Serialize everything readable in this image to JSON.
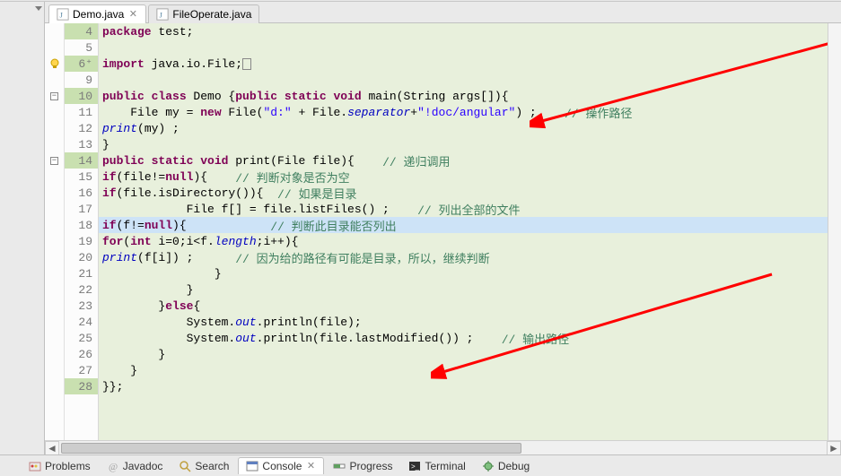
{
  "tabs": [
    {
      "label": "Demo.java",
      "active": true,
      "dirty": false
    },
    {
      "label": "FileOperate.java",
      "active": false,
      "dirty": false
    }
  ],
  "active_tab_close_glyph": "✕",
  "gutter": {
    "lines": [
      {
        "n": "4",
        "change": true
      },
      {
        "n": "5",
        "change": false
      },
      {
        "n": "6",
        "change": true,
        "bulb": true,
        "folded": true
      },
      {
        "n": "9",
        "change": false
      },
      {
        "n": "10",
        "change": true,
        "fold": "-"
      },
      {
        "n": "11",
        "change": false
      },
      {
        "n": "12",
        "change": false
      },
      {
        "n": "13",
        "change": false
      },
      {
        "n": "14",
        "change": true,
        "fold": "-"
      },
      {
        "n": "15",
        "change": false
      },
      {
        "n": "16",
        "change": false
      },
      {
        "n": "17",
        "change": false
      },
      {
        "n": "18",
        "change": false,
        "hl": true
      },
      {
        "n": "19",
        "change": false
      },
      {
        "n": "20",
        "change": false
      },
      {
        "n": "21",
        "change": false
      },
      {
        "n": "22",
        "change": false
      },
      {
        "n": "23",
        "change": false
      },
      {
        "n": "24",
        "change": false
      },
      {
        "n": "25",
        "change": false
      },
      {
        "n": "26",
        "change": false
      },
      {
        "n": "27",
        "change": false
      },
      {
        "n": "28",
        "change": true
      }
    ]
  },
  "code": {
    "l4": {
      "indent": "",
      "tokens": [
        [
          "kw",
          "package"
        ],
        [
          "",
          " test;"
        ]
      ]
    },
    "l5": {
      "indent": "",
      "tokens": []
    },
    "l6": {
      "indent": "",
      "tokens": [
        [
          "kw",
          "import"
        ],
        [
          "",
          " java.io.File;"
        ],
        [
          "box",
          "▢"
        ]
      ]
    },
    "l9": {
      "indent": "",
      "tokens": []
    },
    "l10": {
      "indent": "",
      "tokens": [
        [
          "kw",
          "public class"
        ],
        [
          "",
          " Demo {"
        ],
        [
          "kw",
          "public static void"
        ],
        [
          "",
          " main(String args[]){"
        ]
      ]
    },
    "l11": {
      "indent": "    ",
      "tokens": [
        [
          "",
          "File my = "
        ],
        [
          "kw",
          "new"
        ],
        [
          "",
          " File("
        ],
        [
          "str",
          "\"d:\""
        ],
        [
          "",
          " + File."
        ],
        [
          "field",
          "separator"
        ],
        [
          "",
          "+"
        ],
        [
          "str",
          "\"!doc/angular\""
        ],
        [
          "",
          ") ;    "
        ],
        [
          "cm",
          "// 操作路径"
        ]
      ]
    },
    "l12": {
      "indent": "    ",
      "tokens": [
        [
          "field",
          "print"
        ],
        [
          "",
          "(my) ;"
        ]
      ]
    },
    "l13": {
      "indent": "",
      "tokens": [
        [
          "",
          "}"
        ]
      ]
    },
    "l14": {
      "indent": "",
      "tokens": [
        [
          "kw",
          "public static void"
        ],
        [
          "",
          " print(File file){    "
        ],
        [
          "cm",
          "// 递归调用"
        ]
      ]
    },
    "l15": {
      "indent": "    ",
      "tokens": [
        [
          "kw",
          "if"
        ],
        [
          "",
          "(file!="
        ],
        [
          "kw",
          "null"
        ],
        [
          "",
          "){    "
        ],
        [
          "cm",
          "// 判断对象是否为空"
        ]
      ]
    },
    "l16": {
      "indent": "        ",
      "tokens": [
        [
          "kw",
          "if"
        ],
        [
          "",
          "(file.isDirectory()){  "
        ],
        [
          "cm",
          "// 如果是目录"
        ]
      ]
    },
    "l17": {
      "indent": "            ",
      "tokens": [
        [
          "",
          "File f[] = file.listFiles() ;    "
        ],
        [
          "cm",
          "// 列出全部的文件"
        ]
      ]
    },
    "l18": {
      "indent": "            ",
      "tokens": [
        [
          "kw",
          "if"
        ],
        [
          "",
          "(f!="
        ],
        [
          "kw",
          "null"
        ],
        [
          "",
          "){            "
        ],
        [
          "cm",
          "// 判断此目录能否列出"
        ]
      ]
    },
    "l19": {
      "indent": "                ",
      "tokens": [
        [
          "kw",
          "for"
        ],
        [
          "",
          "("
        ],
        [
          "kw",
          "int"
        ],
        [
          "",
          " i=0;i<f."
        ],
        [
          "field",
          "length"
        ],
        [
          "",
          ";i++){"
        ]
      ]
    },
    "l20": {
      "indent": "                    ",
      "tokens": [
        [
          "field",
          "print"
        ],
        [
          "",
          "(f[i]) ;      "
        ],
        [
          "cm",
          "// 因为给的路径有可能是目录，所以，继续判断"
        ]
      ]
    },
    "l21": {
      "indent": "                ",
      "tokens": [
        [
          "",
          "}"
        ]
      ]
    },
    "l22": {
      "indent": "            ",
      "tokens": [
        [
          "",
          "}"
        ]
      ]
    },
    "l23": {
      "indent": "        ",
      "tokens": [
        [
          "",
          "}"
        ],
        [
          "kw",
          "else"
        ],
        [
          "",
          "{"
        ]
      ]
    },
    "l24": {
      "indent": "            ",
      "tokens": [
        [
          "",
          "System."
        ],
        [
          "field",
          "out"
        ],
        [
          "",
          ".println(file);"
        ]
      ]
    },
    "l25": {
      "indent": "            ",
      "tokens": [
        [
          "",
          "System."
        ],
        [
          "field",
          "out"
        ],
        [
          "",
          ".println(file.lastModified()) ;    "
        ],
        [
          "cm",
          "// 输出路径"
        ]
      ]
    },
    "l26": {
      "indent": "        ",
      "tokens": [
        [
          "",
          "}"
        ]
      ]
    },
    "l27": {
      "indent": "    ",
      "tokens": [
        [
          "",
          "}"
        ]
      ]
    },
    "l28": {
      "indent": "",
      "tokens": [
        [
          "",
          "}};"
        ]
      ]
    }
  },
  "bottom_views": [
    {
      "label": "Problems",
      "icon": "problems"
    },
    {
      "label": "Javadoc",
      "icon": "javadoc"
    },
    {
      "label": "Search",
      "icon": "search"
    },
    {
      "label": "Console",
      "icon": "console",
      "active": true,
      "closable": true
    },
    {
      "label": "Progress",
      "icon": "progress"
    },
    {
      "label": "Terminal",
      "icon": "terminal"
    },
    {
      "label": "Debug",
      "icon": "debug"
    }
  ],
  "hscroll_left": "◄",
  "hscroll_right": "►"
}
